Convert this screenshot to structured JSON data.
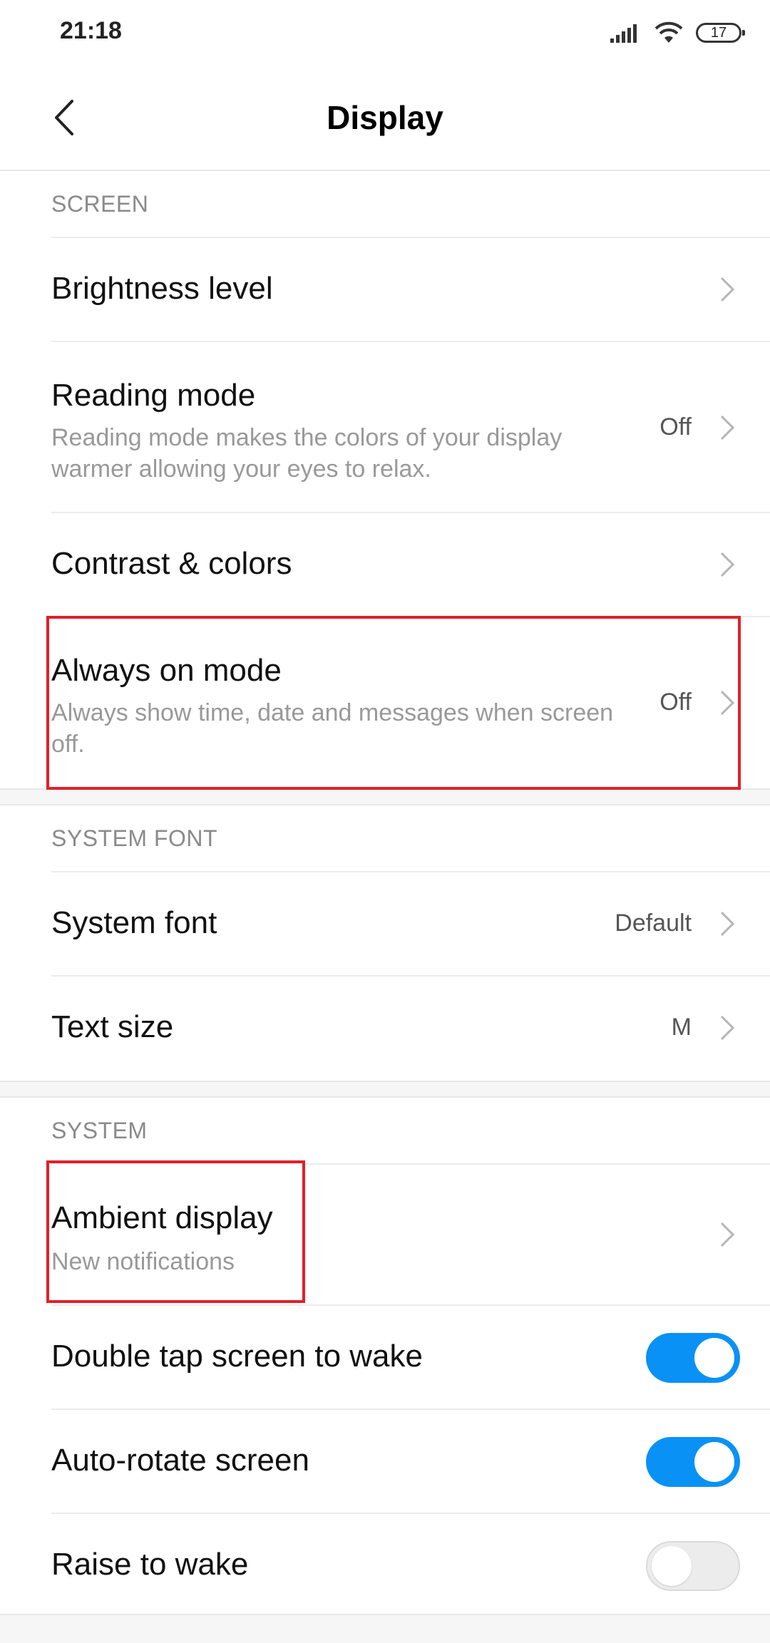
{
  "status_bar": {
    "time": "21:18",
    "battery": "17"
  },
  "header": {
    "title": "Display"
  },
  "sections": {
    "screen": {
      "header": "SCREEN",
      "brightness": {
        "title": "Brightness level"
      },
      "reading_mode": {
        "title": "Reading mode",
        "subtitle": "Reading mode makes the colors of your display warmer allowing your eyes to relax.",
        "value": "Off"
      },
      "contrast": {
        "title": "Contrast & colors"
      },
      "always_on": {
        "title": "Always on mode",
        "subtitle": "Always show time, date and messages when screen off.",
        "value": "Off"
      }
    },
    "system_font": {
      "header": "SYSTEM FONT",
      "font": {
        "title": "System font",
        "value": "Default"
      },
      "text_size": {
        "title": "Text size",
        "value": "M"
      }
    },
    "system": {
      "header": "SYSTEM",
      "ambient": {
        "title": "Ambient display",
        "subtitle": "New notifications"
      },
      "double_tap": {
        "title": "Double tap screen to wake",
        "enabled": true
      },
      "auto_rotate": {
        "title": "Auto-rotate screen",
        "enabled": true
      },
      "raise_to_wake": {
        "title": "Raise to wake",
        "enabled": false
      }
    }
  },
  "colors": {
    "accent": "#0a91f5",
    "highlight": "#e0202a"
  }
}
